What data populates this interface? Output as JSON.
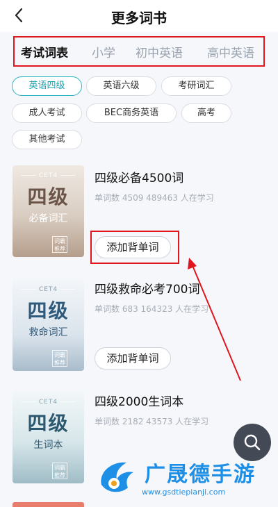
{
  "header": {
    "title": "更多词书",
    "back_icon": "chevron-left-icon"
  },
  "tabs": [
    {
      "label": "考试词表",
      "active": true
    },
    {
      "label": "小学",
      "active": false
    },
    {
      "label": "初中英语",
      "active": false
    },
    {
      "label": "高中英语",
      "active": false
    }
  ],
  "chips": [
    {
      "label": "英语四级",
      "active": true
    },
    {
      "label": "英语六级",
      "active": false
    },
    {
      "label": "考研词汇",
      "active": false
    },
    {
      "label": "成人考试",
      "active": false
    },
    {
      "label": "BEC商务英语",
      "active": false
    },
    {
      "label": "高考",
      "active": false
    },
    {
      "label": "其他考试",
      "active": false
    }
  ],
  "books": [
    {
      "title": "四级必备4500词",
      "stats": "单词数 4509  489463 人在学习",
      "button": "添加背单词",
      "cover": {
        "tag": "CET4",
        "big": "四级",
        "sub": "必备词汇",
        "stamp": "词霸推荐"
      }
    },
    {
      "title": "四级救命必考700词",
      "stats": "单词数 683  164323 人在学习",
      "button": "添加背单词",
      "cover": {
        "tag": "CET4",
        "big": "四级",
        "sub": "救命词汇",
        "stamp": "词霸推荐"
      }
    },
    {
      "title": "四级2000生词本",
      "stats": "单词数 2182  43573 人在学习",
      "button": "",
      "cover": {
        "tag": "CET4",
        "big": "四级",
        "sub": "生词本",
        "stamp": "词霸推荐"
      }
    }
  ],
  "fab": {
    "icon": "search-icon"
  },
  "watermark": {
    "text": "广晟德手游",
    "url": "www.gsdtiepianji.com"
  },
  "colors": {
    "highlight": "#e0161f",
    "accent": "#2bb6c6",
    "watermark": "#1e8fe6"
  }
}
